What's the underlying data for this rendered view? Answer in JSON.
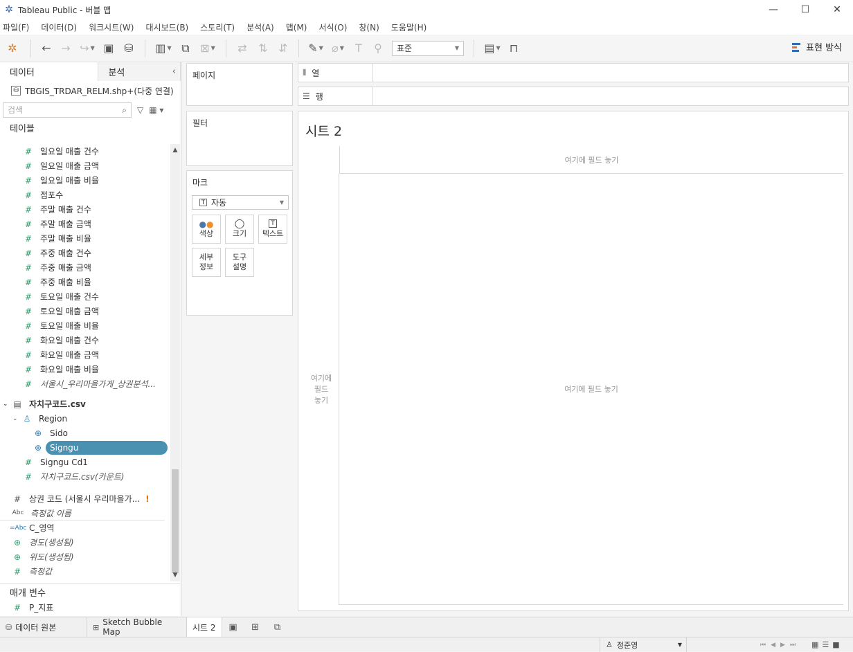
{
  "window": {
    "title": "Tableau Public - 버블 맵"
  },
  "menu": [
    "파일(F)",
    "데이터(D)",
    "워크시트(W)",
    "대시보드(B)",
    "스토리(T)",
    "분석(A)",
    "맵(M)",
    "서식(O)",
    "창(N)",
    "도움말(H)"
  ],
  "toolbar": {
    "fit": "표준",
    "show_me": "표현 방식"
  },
  "left": {
    "tab_data": "데이터",
    "tab_analysis": "분석",
    "datasource": "TBGIS_TRDAR_RELM.shp+(다중 연결)",
    "search_placeholder": "검색",
    "tables_header": "테이블",
    "fields": [
      "일요일 매출 건수",
      "일요일 매출 금액",
      "일요일 매출 비율",
      "점포수",
      "주말 매출 건수",
      "주말 매출 금액",
      "주말 매출 비율",
      "주중 매출 건수",
      "주중 매출 금액",
      "주중 매출 비율",
      "토요일 매출 건수",
      "토요일 매출 금액",
      "토요일 매출 비율",
      "화요일 매출 건수",
      "화요일 매출 금액",
      "화요일 매출 비율",
      "서울시_우리마을가게_상권분석..."
    ],
    "table2": {
      "name": "자치구코드.csv",
      "hierarchy": "Region",
      "sido": "Sido",
      "signgu": "Signgu",
      "signgu_cd": "Signgu Cd1",
      "count": "자치구코드.csv(카운트)"
    },
    "measures": {
      "m1": "상권 코드 (서울시 우리마을가...",
      "m2": "측정값 이름",
      "m3": "C_영역",
      "m4": "경도(생성됨)",
      "m5": "위도(생성됨)",
      "m6": "측정값"
    },
    "params_header": "매개 변수",
    "param1": "P_지표"
  },
  "shelves": {
    "pages": "페이지",
    "filters": "필터",
    "marks": "마크",
    "mark_type": "자동",
    "color": "색상",
    "size": "크기",
    "text": "텍스트",
    "detail_1": "세부",
    "detail_2": "정보",
    "tooltip_1": "도구",
    "tooltip_2": "설명",
    "columns": "열",
    "rows": "행"
  },
  "canvas": {
    "title": "시트 2",
    "drop_here": "여기에 필드 놓기",
    "drop_rows_1": "여기에",
    "drop_rows_2": "필드",
    "drop_rows_3": "놓기"
  },
  "tabs": {
    "datasource": "데이터 원본",
    "sheet1": "Sketch Bubble Map",
    "sheet2": "시트 2"
  },
  "status": {
    "user": "정준영"
  }
}
